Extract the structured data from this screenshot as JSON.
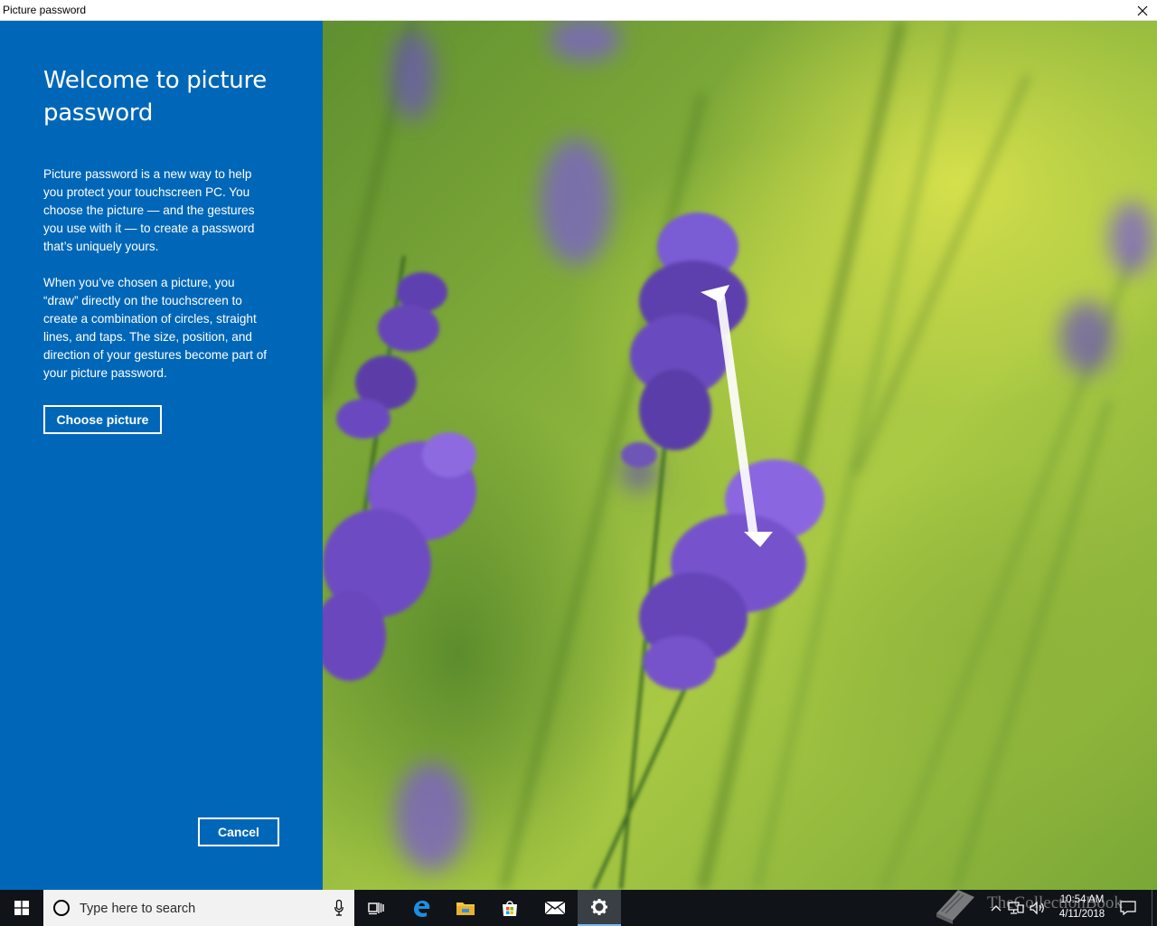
{
  "window": {
    "title": "Picture password",
    "close_glyph": "✕"
  },
  "panel": {
    "heading": "Welcome to picture password",
    "paragraph1": "Picture password is a new way to help you protect your touchscreen PC. You choose the picture — and the gestures you use with it — to create a password that’s uniquely yours.",
    "paragraph2": "When you’ve chosen a picture, you “draw” directly on the touchscreen to create a combination of circles, straight lines, and taps. The size, position, and direction of your gestures become part of your picture password.",
    "choose_button": "Choose picture",
    "cancel_button": "Cancel",
    "bg_color": "#0067b8"
  },
  "picture": {
    "subject": "lavender flowers",
    "gesture": "straight line"
  },
  "taskbar": {
    "search_placeholder": "Type here to search",
    "pinned": [
      "task-view-icon",
      "edge-icon",
      "file-explorer-icon",
      "store-icon",
      "mail-icon",
      "settings-icon"
    ],
    "active": "settings-icon",
    "clock_time": "10:54 AM",
    "clock_date": "4/11/2018",
    "watermark": "TheCollectionBook"
  }
}
